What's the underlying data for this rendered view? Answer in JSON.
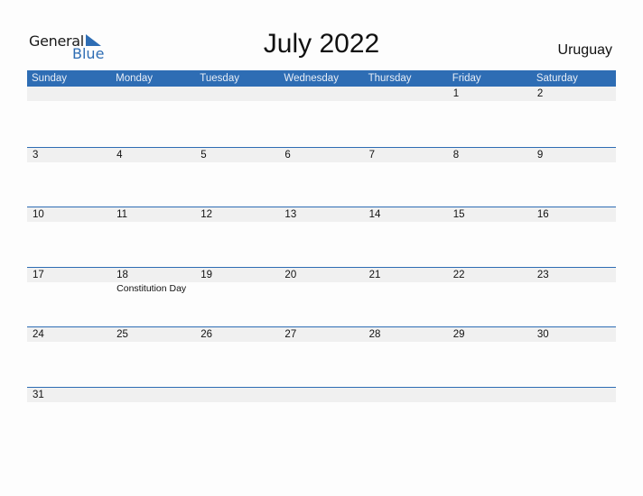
{
  "logo": {
    "general": "General",
    "blue": "Blue"
  },
  "title": "July 2022",
  "country": "Uruguay",
  "weekdays": [
    "Sunday",
    "Monday",
    "Tuesday",
    "Wednesday",
    "Thursday",
    "Friday",
    "Saturday"
  ],
  "weeks": [
    {
      "days": [
        "",
        "",
        "",
        "",
        "",
        "1",
        "2"
      ],
      "events": [
        "",
        "",
        "",
        "",
        "",
        "",
        ""
      ]
    },
    {
      "days": [
        "3",
        "4",
        "5",
        "6",
        "7",
        "8",
        "9"
      ],
      "events": [
        "",
        "",
        "",
        "",
        "",
        "",
        ""
      ]
    },
    {
      "days": [
        "10",
        "11",
        "12",
        "13",
        "14",
        "15",
        "16"
      ],
      "events": [
        "",
        "",
        "",
        "",
        "",
        "",
        ""
      ]
    },
    {
      "days": [
        "17",
        "18",
        "19",
        "20",
        "21",
        "22",
        "23"
      ],
      "events": [
        "",
        "Constitution Day",
        "",
        "",
        "",
        "",
        ""
      ]
    },
    {
      "days": [
        "24",
        "25",
        "26",
        "27",
        "28",
        "29",
        "30"
      ],
      "events": [
        "",
        "",
        "",
        "",
        "",
        "",
        ""
      ]
    },
    {
      "days": [
        "31",
        "",
        "",
        "",
        "",
        "",
        ""
      ],
      "events": [
        "",
        "",
        "",
        "",
        "",
        "",
        ""
      ]
    }
  ],
  "colors": {
    "accent": "#2e6db4",
    "row_shade": "#f0f0f0"
  }
}
